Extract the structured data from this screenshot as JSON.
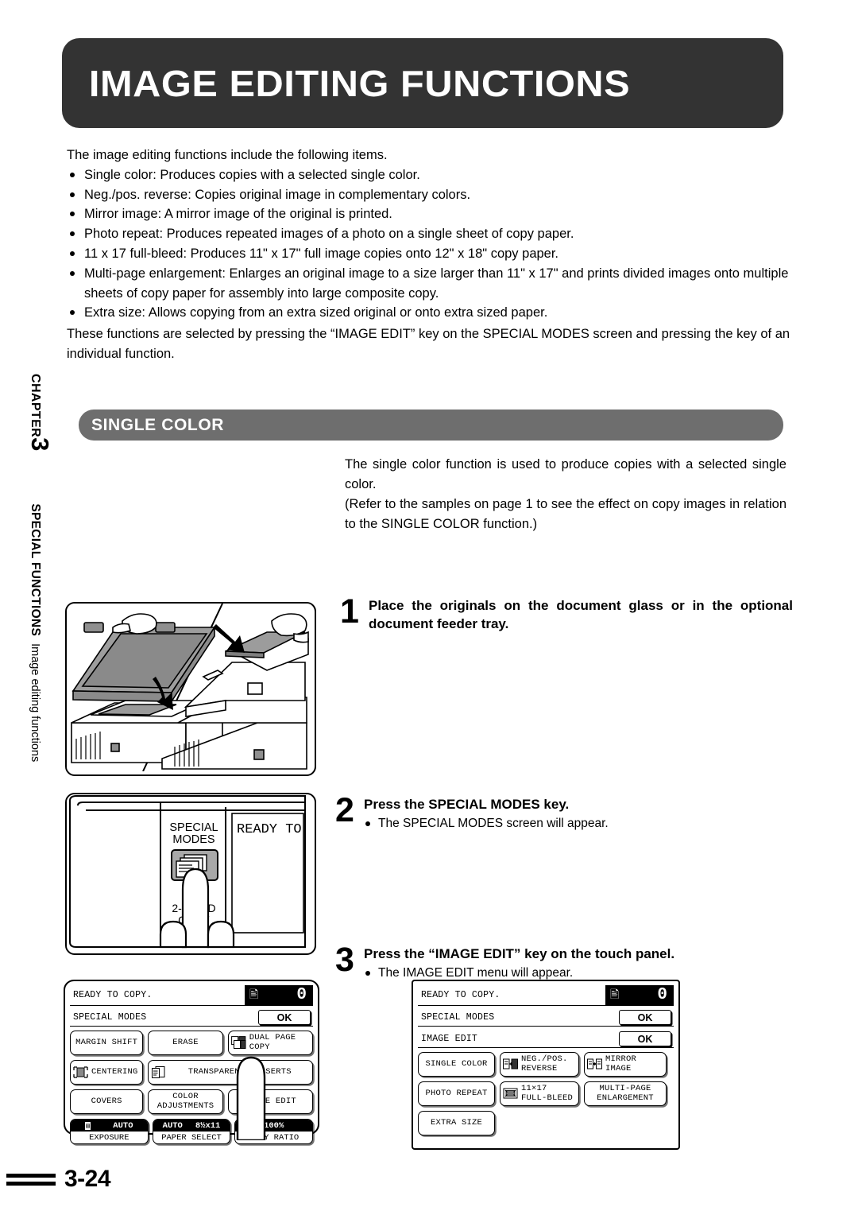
{
  "page": {
    "title": "IMAGE EDITING FUNCTIONS",
    "number": "3-24"
  },
  "rail": {
    "chapter_word": "CHAPTER",
    "chapter_number": "3",
    "section_name": "SPECIAL FUNCTIONS",
    "sub_name": "Image editing functions"
  },
  "intro": {
    "lead": "The image editing functions include the following items.",
    "bullets": [
      "Single color: Produces copies with a selected single color.",
      "Neg./pos. reverse: Copies original image in complementary colors.",
      "Mirror image: A mirror image of the original is printed.",
      "Photo repeat: Produces repeated images of a photo on a single sheet of copy paper.",
      "11 x 17 full-bleed: Produces 11\" x 17\" full image copies onto 12\" x 18\" copy paper.",
      "Multi-page enlargement: Enlarges an original image to a size larger than 11\" x 17\" and prints divided images onto multiple sheets of copy paper for assembly into large composite copy.",
      "Extra size: Allows copying from an extra sized original or onto extra sized paper."
    ],
    "paragraph": "These functions are selected by pressing the “IMAGE EDIT” key on the SPECIAL MODES screen and pressing the key of an individual function."
  },
  "section": {
    "heading": "SINGLE COLOR",
    "description": "The single color function is used to produce copies with a selected single color.\n(Refer to the samples on page 1 to see the effect on copy images in relation to the SINGLE COLOR function.)"
  },
  "steps": [
    {
      "number": "1",
      "title": "Place the originals on the document glass or in the optional document feeder tray.",
      "note": ""
    },
    {
      "number": "2",
      "title": "Press the SPECIAL MODES key.",
      "note": "The SPECIAL MODES screen will appear."
    },
    {
      "number": "3",
      "title": "Press the “IMAGE EDIT” key on the touch panel.",
      "note": "The IMAGE EDIT menu will appear."
    }
  ],
  "panel_illustration": {
    "key_label_line1": "SPECIAL",
    "key_label_line2": "MODES",
    "other_key_line1": "2-SIDED",
    "other_key_line2": "COPY",
    "screen_text": "READY TO"
  },
  "lcd_left": {
    "status": "READY TO COPY.",
    "copy_icon": "copies-icon",
    "count": "0",
    "header_label": "SPECIAL MODES",
    "ok_label": "OK",
    "keys_row1": [
      {
        "label": "MARGIN SHIFT",
        "icon": ""
      },
      {
        "label": "ERASE",
        "icon": ""
      },
      {
        "label": "DUAL PAGE\nCOPY",
        "icon": "dual-page-icon"
      }
    ],
    "keys_row2": [
      {
        "label": "CENTERING",
        "icon": "centering-icon"
      },
      {
        "label": "TRANSPARENCY INSERTS",
        "icon": "transparency-icon"
      }
    ],
    "keys_row3": [
      {
        "label": "COVERS",
        "icon": ""
      },
      {
        "label": "COLOR\nADJUSTMENTS",
        "icon": ""
      },
      {
        "label": "IMAGE EDIT",
        "icon": ""
      }
    ],
    "bottom_keys": [
      {
        "top": "AUTO",
        "bottom": "EXPOSURE",
        "icon": "exposure-icon"
      },
      {
        "top_left": "AUTO",
        "top_right": "8½x11",
        "bottom": "PAPER SELECT"
      },
      {
        "top": "100%",
        "bottom": "COPY RATIO"
      }
    ]
  },
  "lcd_right": {
    "status": "READY TO COPY.",
    "copy_icon": "copies-icon",
    "count": "0",
    "header_label": "SPECIAL MODES",
    "ok_label": "OK",
    "sub_header_label": "IMAGE EDIT",
    "sub_ok_label": "OK",
    "keys_row1": [
      {
        "label": "SINGLE COLOR",
        "icon": ""
      },
      {
        "label": "NEG./POS.\nREVERSE",
        "icon": "negpos-icon"
      },
      {
        "label": "MIRROR\nIMAGE",
        "icon": "mirror-icon"
      }
    ],
    "keys_row2": [
      {
        "label": "PHOTO REPEAT",
        "icon": ""
      },
      {
        "label": "11×17\nFULL-BLEED",
        "icon": "fullbleed-icon"
      },
      {
        "label": "MULTI-PAGE\nENLARGEMENT",
        "icon": ""
      }
    ],
    "keys_row3": [
      {
        "label": "EXTRA SIZE",
        "icon": ""
      }
    ]
  },
  "colors": {
    "title_banner": "#333333",
    "section_banner": "#6e6e6e",
    "text": "#000000",
    "page_bg": "#ffffff"
  }
}
